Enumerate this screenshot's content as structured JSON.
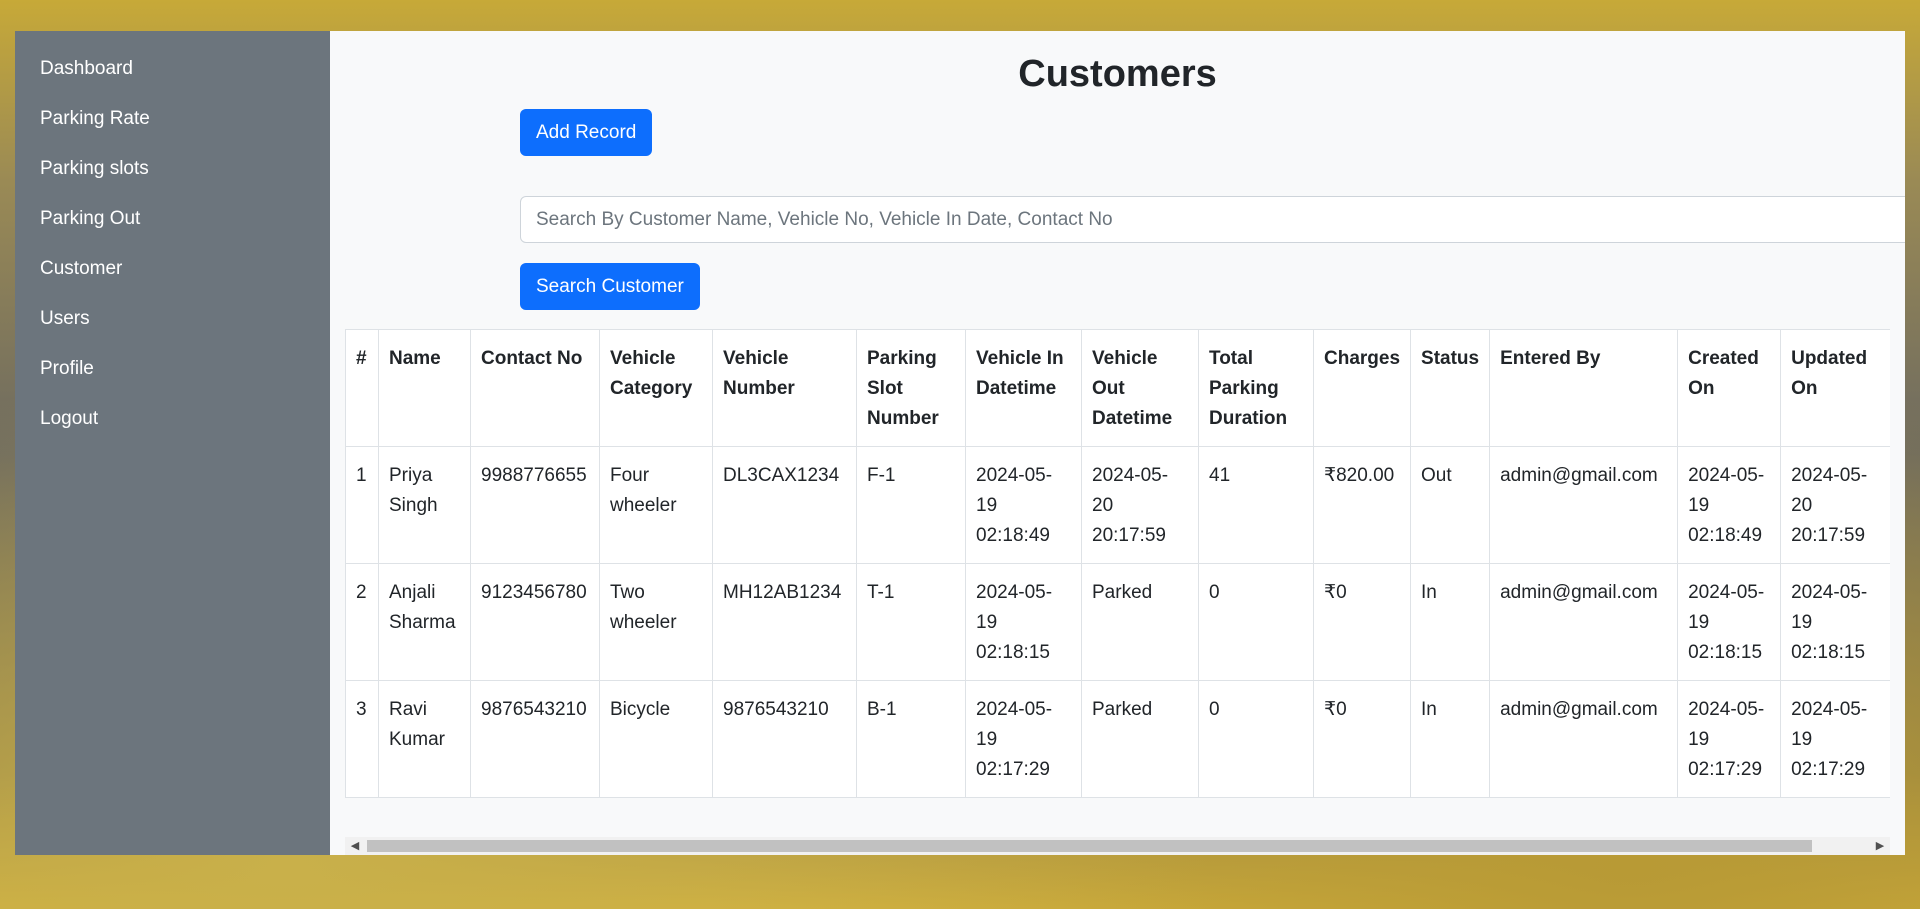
{
  "sidebar": {
    "items": [
      {
        "label": "Dashboard"
      },
      {
        "label": "Parking Rate"
      },
      {
        "label": "Parking slots"
      },
      {
        "label": "Parking Out"
      },
      {
        "label": "Customer"
      },
      {
        "label": "Users"
      },
      {
        "label": "Profile"
      },
      {
        "label": "Logout"
      }
    ]
  },
  "main": {
    "title": "Customers",
    "add_label": "Add Record",
    "search_placeholder": "Search By Customer Name, Vehicle No, Vehicle In Date, Contact No",
    "search_value": "",
    "search_button_label": "Search Customer"
  },
  "table": {
    "headers": [
      "#",
      "Name",
      "Contact No",
      "Vehicle Category",
      "Vehicle Number",
      "Parking Slot Number",
      "Vehicle In Datetime",
      "Vehicle Out Datetime",
      "Total Parking Duration",
      "Charges",
      "Status",
      "Entered By",
      "Created On",
      "Updated On"
    ],
    "rows": [
      [
        "1",
        "Priya Singh",
        "9988776655",
        "Four wheeler",
        "DL3CAX1234",
        "F-1",
        "2024-05-19 02:18:49",
        "2024-05-20 20:17:59",
        "41",
        "₹820.00",
        "Out",
        "admin@gmail.com",
        "2024-05-19 02:18:49",
        "2024-05-20 20:17:59"
      ],
      [
        "2",
        "Anjali Sharma",
        "9123456780",
        "Two wheeler",
        "MH12AB1234",
        "T-1",
        "2024-05-19 02:18:15",
        "Parked",
        "0",
        "₹0",
        "In",
        "admin@gmail.com",
        "2024-05-19 02:18:15",
        "2024-05-19 02:18:15"
      ],
      [
        "3",
        "Ravi Kumar",
        "9876543210",
        "Bicycle",
        "9876543210",
        "B-1",
        "2024-05-19 02:17:29",
        "Parked",
        "0",
        "₹0",
        "In",
        "admin@gmail.com",
        "2024-05-19 02:17:29",
        "2024-05-19 02:17:29"
      ]
    ]
  },
  "scrollbar": {
    "left_arrow": "◀",
    "right_arrow": "▶"
  }
}
